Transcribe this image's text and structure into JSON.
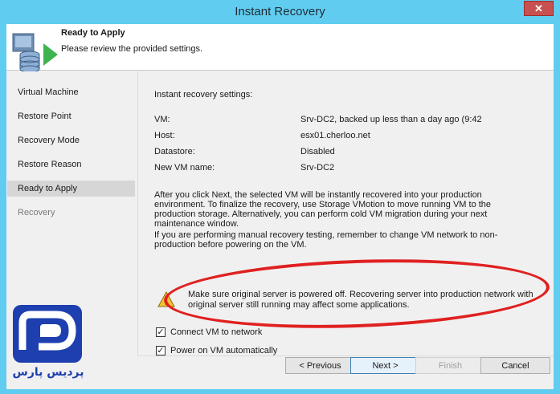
{
  "window": {
    "title": "Instant Recovery",
    "close_glyph": "✕"
  },
  "header": {
    "title": "Ready to Apply",
    "subtitle": "Please review the provided  settings.",
    "icon": "server-restore-icon"
  },
  "sidebar": {
    "items": [
      {
        "label": "Virtual Machine",
        "state": "normal"
      },
      {
        "label": "Restore Point",
        "state": "normal"
      },
      {
        "label": "Recovery Mode",
        "state": "normal"
      },
      {
        "label": "Restore Reason",
        "state": "normal"
      },
      {
        "label": "Ready to Apply",
        "state": "active"
      },
      {
        "label": "Recovery",
        "state": "disabled"
      }
    ]
  },
  "main": {
    "section_label": "Instant recovery settings:",
    "settings": [
      {
        "label": "VM:",
        "value": "Srv-DC2, backed up less than a day ago (9:42"
      },
      {
        "label": "Host:",
        "value": "esx01.cherloo.net"
      },
      {
        "label": "Datastore:",
        "value": "Disabled"
      },
      {
        "label": "New VM name:",
        "value": "Srv-DC2"
      }
    ],
    "info_paragraph": "After you click Next, the selected VM will be instantly recovered into your production environment. To finalize the recovery, use Storage VMotion to move running VM to the production storage. Alternatively, you can perform cold VM migration during your next maintenance window.",
    "testing_paragraph": "If you are performing manual recovery testing, remember to change VM network to non-production before powering on the VM.",
    "warning": "Make sure original server is powered off. Recovering server into production network with original server still running may affect some applications.",
    "checkboxes": [
      {
        "label": "Connect VM to network",
        "checked": true
      },
      {
        "label": "Power on VM automatically",
        "checked": true
      }
    ]
  },
  "buttons": {
    "previous": "< Previous",
    "next": "Next >",
    "finish": "Finish",
    "cancel": "Cancel"
  },
  "watermark": {
    "text": "پردیس پارس"
  },
  "colors": {
    "titlebar": "#60cdf0",
    "close": "#c75050",
    "annotation_ellipse": "#e02020",
    "logo": "#1e3fb0"
  }
}
